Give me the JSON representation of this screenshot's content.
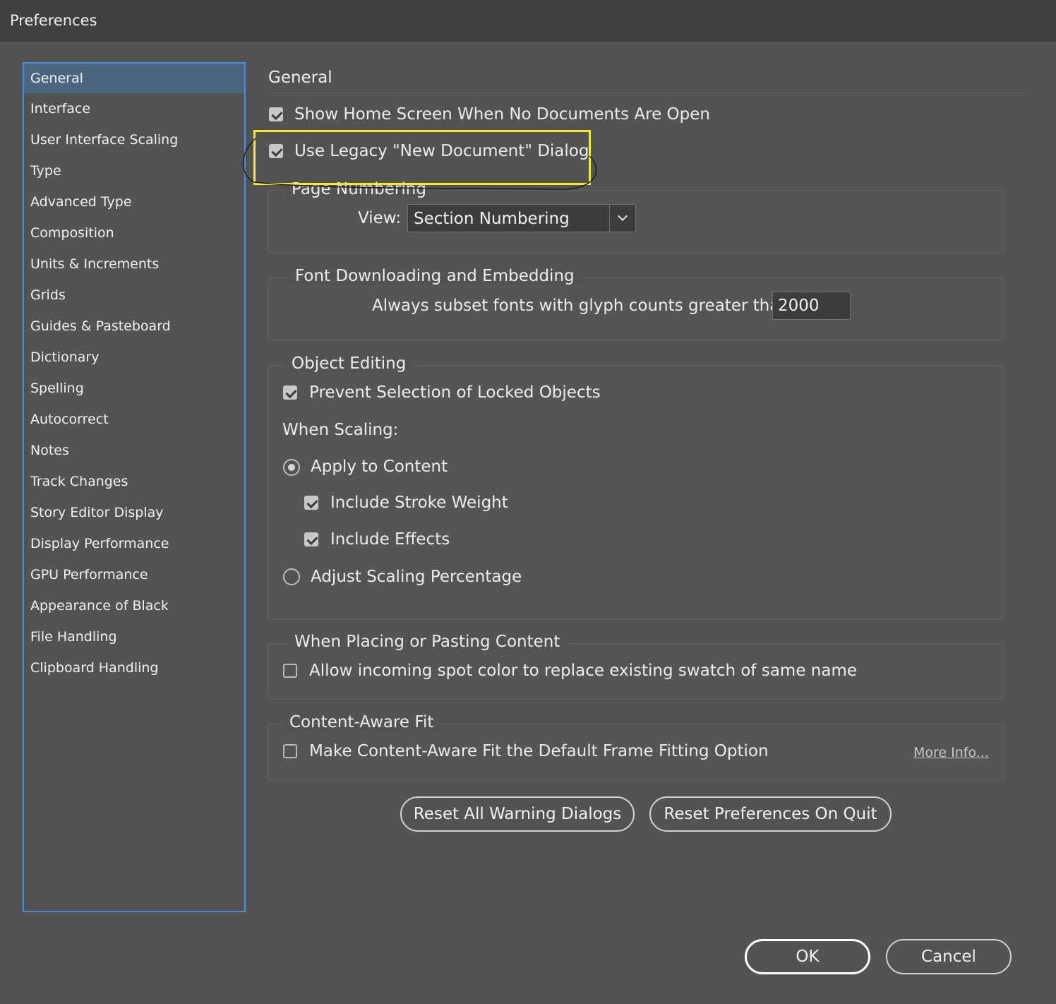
{
  "window": {
    "title": "Preferences"
  },
  "sidebar": {
    "items": [
      {
        "label": "General",
        "active": true
      },
      {
        "label": "Interface"
      },
      {
        "label": "User Interface Scaling"
      },
      {
        "label": "Type"
      },
      {
        "label": "Advanced Type"
      },
      {
        "label": "Composition"
      },
      {
        "label": "Units & Increments"
      },
      {
        "label": "Grids"
      },
      {
        "label": "Guides & Pasteboard"
      },
      {
        "label": "Dictionary"
      },
      {
        "label": "Spelling"
      },
      {
        "label": "Autocorrect"
      },
      {
        "label": "Notes"
      },
      {
        "label": "Track Changes"
      },
      {
        "label": "Story Editor Display"
      },
      {
        "label": "Display Performance"
      },
      {
        "label": "GPU Performance"
      },
      {
        "label": "Appearance of Black"
      },
      {
        "label": "File Handling"
      },
      {
        "label": "Clipboard Handling"
      }
    ]
  },
  "general": {
    "title": "General",
    "show_home_screen": {
      "label": "Show Home Screen When No Documents Are Open",
      "checked": true
    },
    "use_legacy_dialog": {
      "label": "Use Legacy \"New Document\" Dialog",
      "checked": true
    }
  },
  "page_numbering": {
    "legend": "Page Numbering",
    "view_label": "View:",
    "view_value": "Section Numbering"
  },
  "font_downloading": {
    "legend": "Font Downloading and Embedding",
    "subset_label": "Always subset fonts with glyph counts greater than:",
    "subset_value": "2000"
  },
  "object_editing": {
    "legend": "Object Editing",
    "prevent_selection": {
      "label": "Prevent Selection of Locked Objects",
      "checked": true
    },
    "when_scaling_label": "When Scaling:",
    "apply_to_content": {
      "label": "Apply to Content",
      "selected": true
    },
    "include_stroke_weight": {
      "label": "Include Stroke Weight",
      "checked": true
    },
    "include_effects": {
      "label": "Include Effects",
      "checked": true
    },
    "adjust_scaling": {
      "label": "Adjust Scaling Percentage",
      "selected": false
    }
  },
  "placing": {
    "legend": "When Placing or Pasting Content",
    "allow_spot_color": {
      "label": "Allow incoming spot color to replace existing swatch of same name",
      "checked": false
    }
  },
  "content_aware": {
    "legend": "Content-Aware Fit",
    "make_default": {
      "label": "Make Content-Aware Fit the Default Frame Fitting Option",
      "checked": false
    },
    "more_info": "More Info..."
  },
  "buttons": {
    "reset_warnings": "Reset All Warning Dialogs",
    "reset_prefs": "Reset Preferences On Quit",
    "ok": "OK",
    "cancel": "Cancel"
  },
  "colors": {
    "dialog_bg": "#535353",
    "sidebar_active": "#4d6680",
    "sidebar_border": "#4a8fd6",
    "annotation": "#f4ec2a"
  }
}
